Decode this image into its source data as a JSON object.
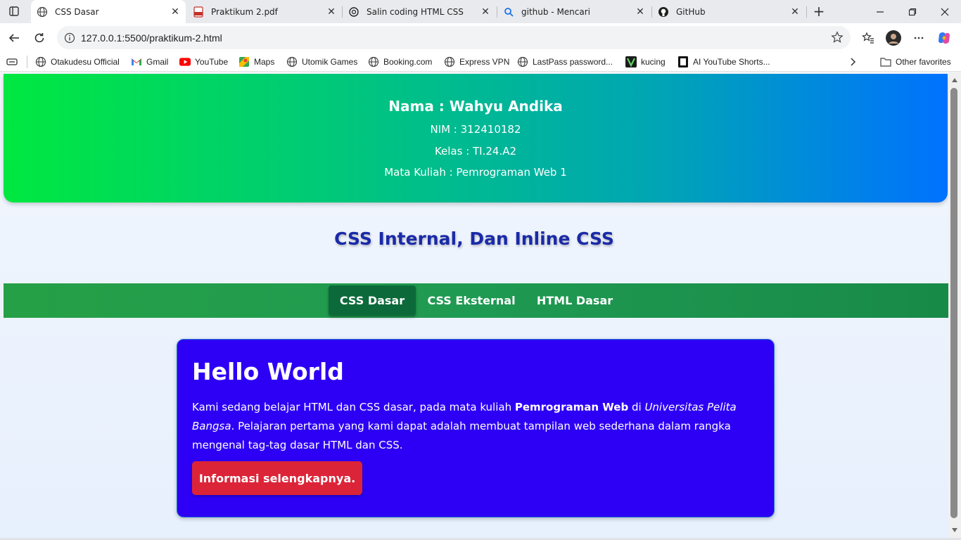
{
  "tabs": [
    {
      "title": "CSS Dasar",
      "icon": "globe-icon",
      "active": true
    },
    {
      "title": "Praktikum 2.pdf",
      "icon": "pdf-icon",
      "active": false
    },
    {
      "title": "Salin coding HTML CSS",
      "icon": "chatgpt-icon",
      "active": false
    },
    {
      "title": "github - Mencari",
      "icon": "search-icon",
      "active": false
    },
    {
      "title": "GitHub",
      "icon": "github-icon",
      "active": false
    }
  ],
  "address": {
    "url": "127.0.0.1:5500/praktikum-2.html"
  },
  "bookmarks": [
    {
      "label": "Otakudesu Official",
      "icon": "globe-icon"
    },
    {
      "label": "Gmail",
      "icon": "gmail-icon"
    },
    {
      "label": "YouTube",
      "icon": "youtube-icon"
    },
    {
      "label": "Maps",
      "icon": "maps-icon"
    },
    {
      "label": "Utomik Games",
      "icon": "globe-icon"
    },
    {
      "label": "Booking.com",
      "icon": "globe-icon"
    },
    {
      "label": "Express VPN",
      "icon": "globe-icon"
    },
    {
      "label": "LastPass password...",
      "icon": "globe-icon"
    },
    {
      "label": "kucing",
      "icon": "vim-icon"
    },
    {
      "label": "AI YouTube Shorts...",
      "icon": "bookmark-black-icon"
    }
  ],
  "other_favorites": "Other favorites",
  "header": {
    "name": "Nama : Wahyu Andika",
    "nim": "NIM : 312410182",
    "kelas": "Kelas : TI.24.A2",
    "matkul": "Mata Kuliah : Pemrograman Web 1"
  },
  "section_title": "CSS Internal, Dan Inline CSS",
  "nav": [
    {
      "label": "CSS Dasar",
      "active": true
    },
    {
      "label": "CSS Eksternal",
      "active": false
    },
    {
      "label": "HTML Dasar",
      "active": false
    }
  ],
  "card": {
    "title": "Hello World",
    "text_1": "Kami sedang belajar HTML dan CSS dasar, pada mata kuliah ",
    "bold": "Pemrograman Web",
    "text_2": " di ",
    "italic": "Universitas Pelita Bangsa",
    "text_3": ". Pelajaran pertama yang kami dapat adalah membuat tampilan web sederhana dalam rangka mengenal tag-tag dasar HTML dan CSS.",
    "button": "Informasi selengkapnya."
  },
  "colors": {
    "header_gradient": [
      "#00e840",
      "#0072ff"
    ],
    "title": "#1a2aa8",
    "navbar": "#1f9a52",
    "nav_active": "#0c6a3a",
    "card": "#2d00f5",
    "button": "#dc2438"
  }
}
